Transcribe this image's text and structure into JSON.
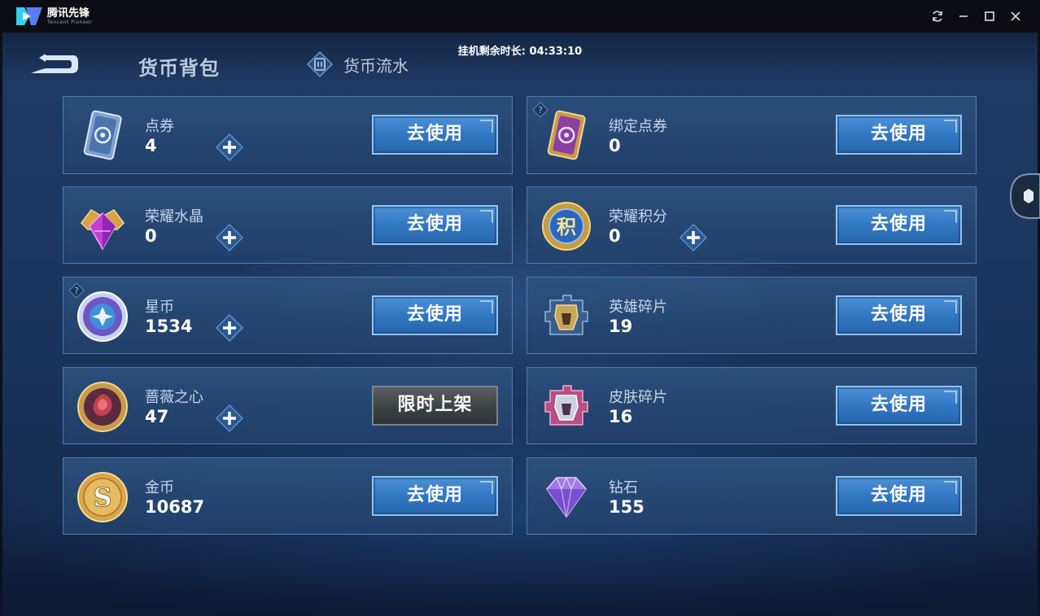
{
  "titlebar": {
    "brand_name": "腾讯先锋",
    "brand_sub": "Tencent Pioneer",
    "controls": [
      "refresh-icon",
      "minimize-icon",
      "maximize-icon",
      "close-icon"
    ]
  },
  "header": {
    "timer": "挂机剩余时长: 04:33:10",
    "title": "货币背包",
    "flow_tab": "货币流水"
  },
  "colors": {
    "accent_button": "#3277c2",
    "card_border": "#78a5d7",
    "limited_button": "#3f4447"
  },
  "cards": [
    {
      "name": "点券",
      "value": "4",
      "icon": "voucher-card-icon",
      "plus": true,
      "help": false,
      "action": "去使用"
    },
    {
      "name": "绑定点券",
      "value": "0",
      "icon": "bound-voucher-card-icon",
      "plus": false,
      "help": true,
      "action": "去使用"
    },
    {
      "name": "荣耀水晶",
      "value": "0",
      "icon": "glory-crystal-icon",
      "plus": true,
      "help": false,
      "action": "去使用"
    },
    {
      "name": "荣耀积分",
      "value": "0",
      "icon": "glory-points-icon",
      "plus": true,
      "help": false,
      "action": "去使用"
    },
    {
      "name": "星币",
      "value": "1534",
      "icon": "star-coin-icon",
      "plus": true,
      "help": true,
      "action": "去使用"
    },
    {
      "name": "英雄碎片",
      "value": "19",
      "icon": "hero-fragment-icon",
      "plus": false,
      "help": false,
      "action": "去使用"
    },
    {
      "name": "蔷薇之心",
      "value": "47",
      "icon": "rose-heart-icon",
      "plus": true,
      "help": false,
      "action": "限时上架"
    },
    {
      "name": "皮肤碎片",
      "value": "16",
      "icon": "skin-fragment-icon",
      "plus": false,
      "help": false,
      "action": "去使用"
    },
    {
      "name": "金币",
      "value": "10687",
      "icon": "gold-coin-icon",
      "plus": false,
      "help": false,
      "action": "去使用"
    },
    {
      "name": "钻石",
      "value": "155",
      "icon": "diamond-icon",
      "plus": false,
      "help": false,
      "action": "去使用"
    }
  ]
}
